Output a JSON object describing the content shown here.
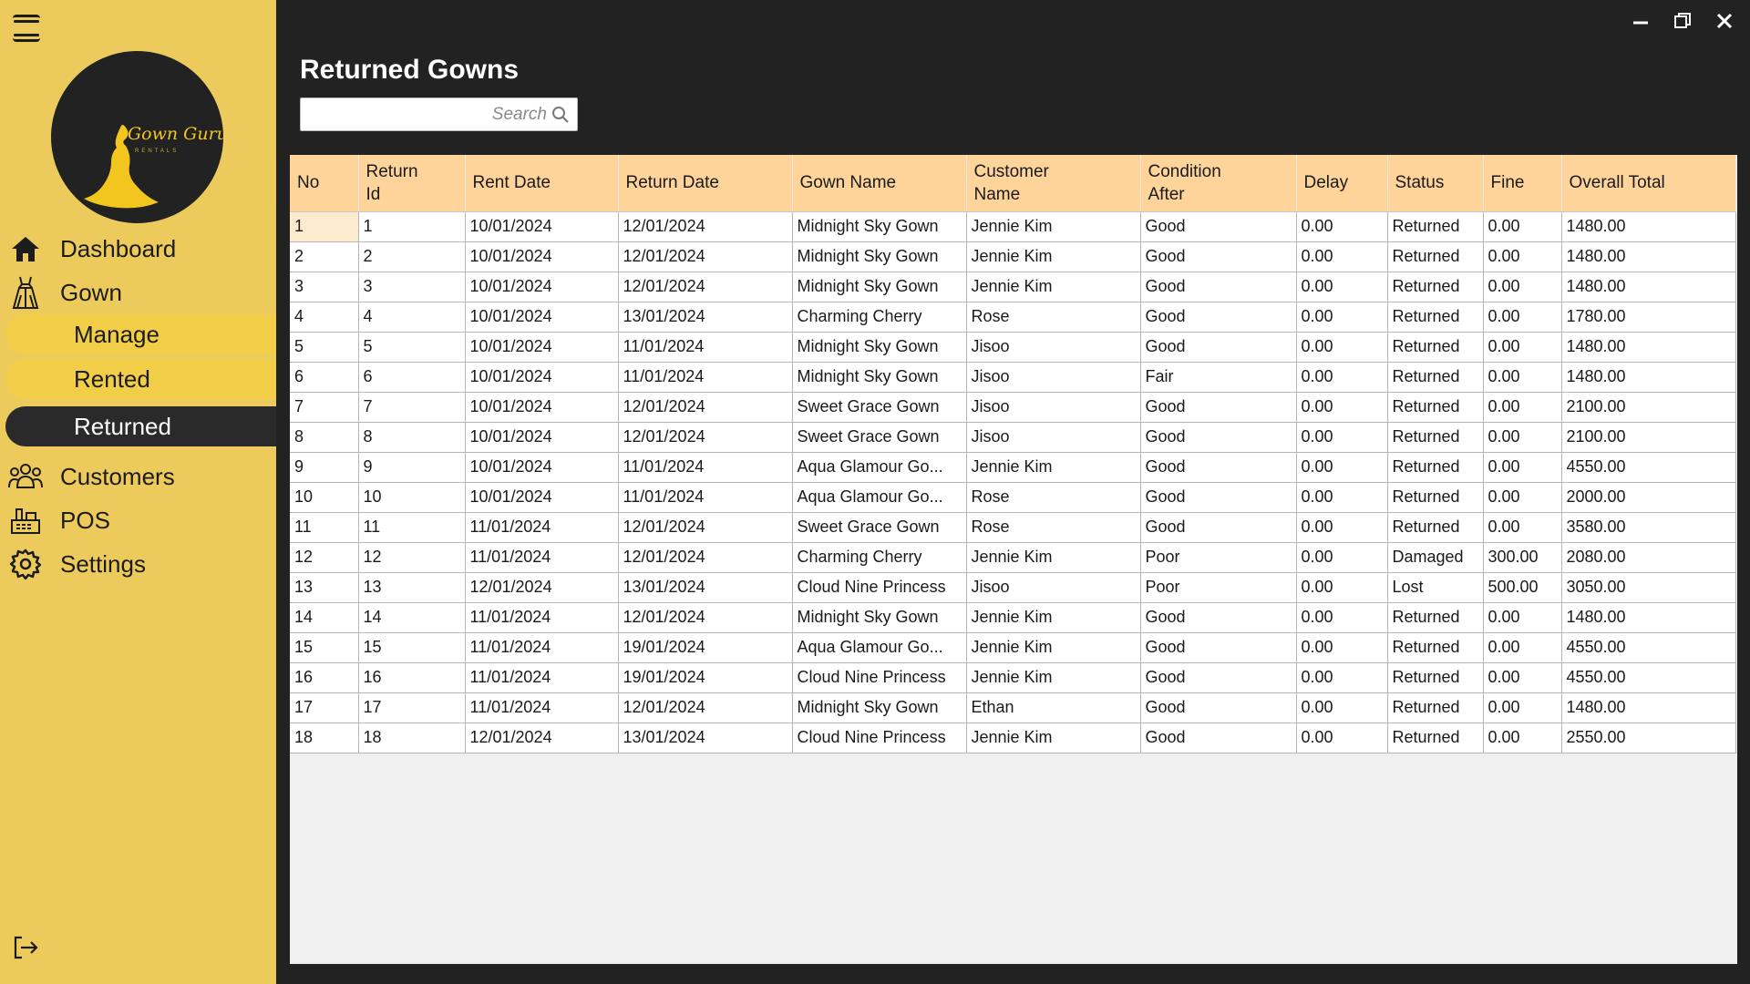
{
  "app": {
    "title": "Returned Gowns",
    "logo_text": "Gown Guru",
    "logo_subtext": "RENTALS"
  },
  "sidebar": {
    "items": [
      {
        "label": "Dashboard",
        "icon": "home-icon"
      },
      {
        "label": "Gown",
        "icon": "gown-icon"
      },
      {
        "label": "Customers",
        "icon": "customers-icon"
      },
      {
        "label": "POS",
        "icon": "pos-icon"
      },
      {
        "label": "Settings",
        "icon": "gear-icon"
      }
    ],
    "gown_sub": [
      {
        "label": "Manage",
        "active": false
      },
      {
        "label": "Rented",
        "active": false
      },
      {
        "label": "Returned",
        "active": true
      }
    ]
  },
  "search": {
    "placeholder": "Search",
    "value": ""
  },
  "table": {
    "columns": [
      "No",
      "Return Id",
      "Rent Date",
      "Return Date",
      "Gown Name",
      "Customer Name",
      "Condition After",
      "Delay",
      "Status",
      "Fine",
      "Overall Total"
    ],
    "rows": [
      [
        "1",
        "1",
        "10/01/2024",
        "12/01/2024",
        "Midnight Sky Gown",
        "Jennie Kim",
        "Good",
        "0.00",
        "Returned",
        "0.00",
        "1480.00"
      ],
      [
        "2",
        "2",
        "10/01/2024",
        "12/01/2024",
        "Midnight Sky Gown",
        "Jennie Kim",
        "Good",
        "0.00",
        "Returned",
        "0.00",
        "1480.00"
      ],
      [
        "3",
        "3",
        "10/01/2024",
        "12/01/2024",
        "Midnight Sky Gown",
        "Jennie Kim",
        "Good",
        "0.00",
        "Returned",
        "0.00",
        "1480.00"
      ],
      [
        "4",
        "4",
        "10/01/2024",
        "13/01/2024",
        "Charming Cherry",
        "Rose",
        "Good",
        "0.00",
        "Returned",
        "0.00",
        "1780.00"
      ],
      [
        "5",
        "5",
        "10/01/2024",
        "11/01/2024",
        "Midnight Sky Gown",
        "Jisoo",
        "Good",
        "0.00",
        "Returned",
        "0.00",
        "1480.00"
      ],
      [
        "6",
        "6",
        "10/01/2024",
        "11/01/2024",
        "Midnight Sky Gown",
        "Jisoo",
        "Fair",
        "0.00",
        "Returned",
        "0.00",
        "1480.00"
      ],
      [
        "7",
        "7",
        "10/01/2024",
        "12/01/2024",
        "Sweet Grace Gown",
        "Jisoo",
        "Good",
        "0.00",
        "Returned",
        "0.00",
        "2100.00"
      ],
      [
        "8",
        "8",
        "10/01/2024",
        "12/01/2024",
        "Sweet Grace Gown",
        "Jisoo",
        "Good",
        "0.00",
        "Returned",
        "0.00",
        "2100.00"
      ],
      [
        "9",
        "9",
        "10/01/2024",
        "11/01/2024",
        "Aqua Glamour Go...",
        "Jennie Kim",
        "Good",
        "0.00",
        "Returned",
        "0.00",
        "4550.00"
      ],
      [
        "10",
        "10",
        "10/01/2024",
        "11/01/2024",
        "Aqua Glamour Go...",
        "Rose",
        "Good",
        "0.00",
        "Returned",
        "0.00",
        "2000.00"
      ],
      [
        "11",
        "11",
        "11/01/2024",
        "12/01/2024",
        "Sweet Grace Gown",
        "Rose",
        "Good",
        "0.00",
        "Returned",
        "0.00",
        "3580.00"
      ],
      [
        "12",
        "12",
        "11/01/2024",
        "12/01/2024",
        "Charming Cherry",
        "Jennie Kim",
        "Poor",
        "0.00",
        "Damaged",
        "300.00",
        "2080.00"
      ],
      [
        "13",
        "13",
        "12/01/2024",
        "13/01/2024",
        "Cloud Nine Princess",
        "Jisoo",
        "Poor",
        "0.00",
        "Lost",
        "500.00",
        "3050.00"
      ],
      [
        "14",
        "14",
        "11/01/2024",
        "12/01/2024",
        "Midnight Sky Gown",
        "Jennie Kim",
        "Good",
        "0.00",
        "Returned",
        "0.00",
        "1480.00"
      ],
      [
        "15",
        "15",
        "11/01/2024",
        "19/01/2024",
        "Aqua Glamour Go...",
        "Jennie Kim",
        "Good",
        "0.00",
        "Returned",
        "0.00",
        "4550.00"
      ],
      [
        "16",
        "16",
        "11/01/2024",
        "19/01/2024",
        "Cloud Nine Princess",
        "Jennie Kim",
        "Good",
        "0.00",
        "Returned",
        "0.00",
        "4550.00"
      ],
      [
        "17",
        "17",
        "11/01/2024",
        "12/01/2024",
        "Midnight Sky Gown",
        "Ethan",
        "Good",
        "0.00",
        "Returned",
        "0.00",
        "1480.00"
      ],
      [
        "18",
        "18",
        "12/01/2024",
        "13/01/2024",
        "Cloud Nine Princess",
        "Jennie Kim",
        "Good",
        "0.00",
        "Returned",
        "0.00",
        "2550.00"
      ]
    ]
  },
  "colors": {
    "sidebar_bg": "#ECCB5C",
    "header_bg": "#FFD49A",
    "window_bg": "#222222",
    "active_nav_bg": "#2a2a2a"
  }
}
